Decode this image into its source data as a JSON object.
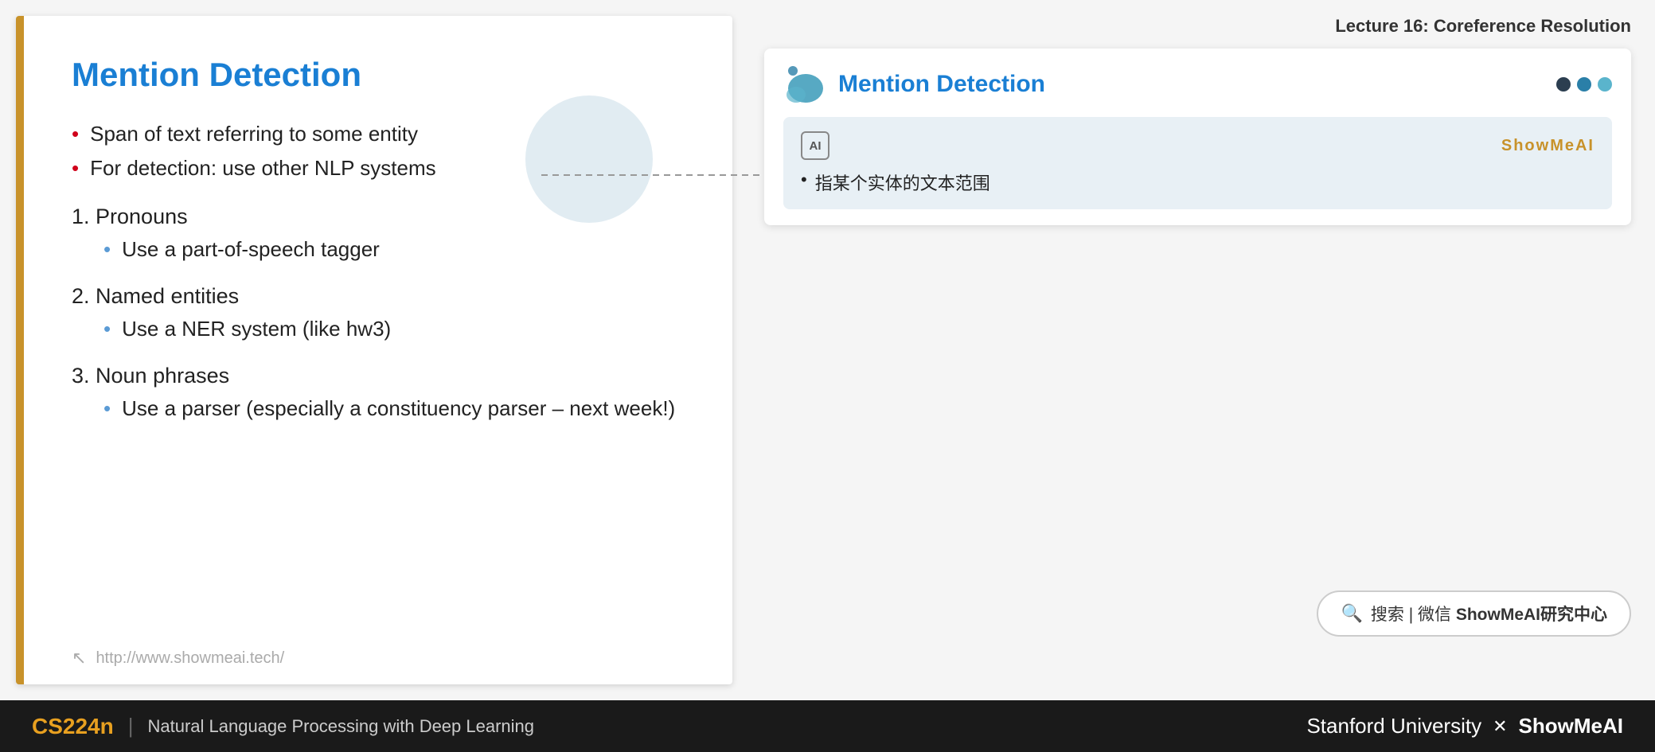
{
  "lecture": {
    "title": "Lecture 16: Coreference Resolution"
  },
  "slide": {
    "title": "Mention Detection",
    "border_color": "#c8922a",
    "bullets": [
      "Span of text referring to some entity",
      "For detection: use other NLP systems"
    ],
    "sections": [
      {
        "number": "1.",
        "heading": "Pronouns",
        "sub_bullet": "Use a part-of-speech tagger"
      },
      {
        "number": "2.",
        "heading": "Named entities",
        "sub_bullet": "Use a NER system (like hw3)"
      },
      {
        "number": "3.",
        "heading": "Noun phrases",
        "sub_bullet": "Use a parser (especially a constituency parser – next week!)"
      }
    ],
    "footer_url": "http://www.showmeai.tech/"
  },
  "preview": {
    "title": "Mention Detection",
    "dots": [
      "dark",
      "teal",
      "light-teal"
    ]
  },
  "annotation": {
    "brand": "ShowMeAI",
    "text": "指某个实体的文本范围",
    "bullet": "•"
  },
  "search": {
    "icon": "🔍",
    "prefix": "搜索 | 微信",
    "brand": "ShowMeAI研究中心"
  },
  "bottom_bar": {
    "course_code": "CS224n",
    "divider": "|",
    "course_name": "Natural Language Processing with Deep Learning",
    "right_text": "Stanford University",
    "x": "✕",
    "right_brand": "ShowMeAI"
  }
}
